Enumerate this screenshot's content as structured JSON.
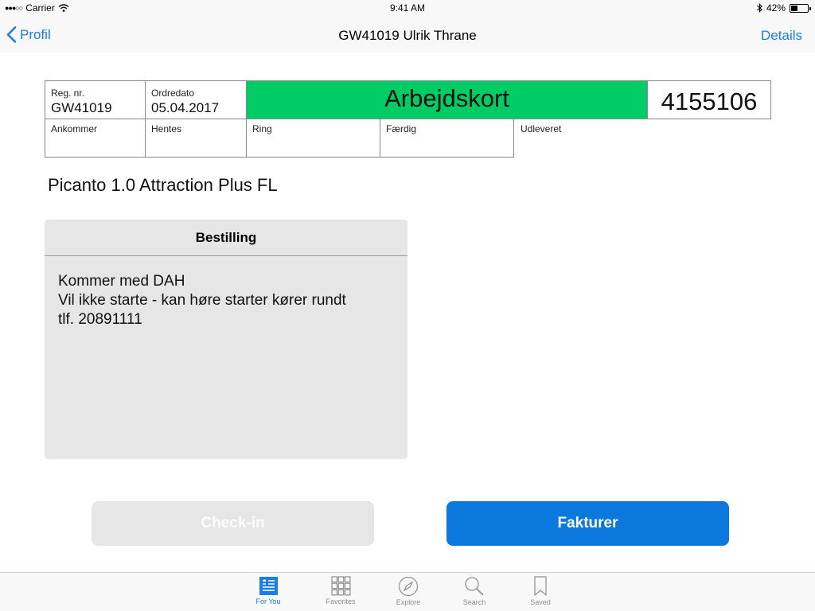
{
  "status_bar": {
    "carrier": "Carrier",
    "time": "9:41 AM",
    "battery": "42%"
  },
  "nav": {
    "back_label": "Profil",
    "title": "GW41019 Ulrik Thrane",
    "details_label": "Details"
  },
  "header": {
    "reg_label": "Reg. nr.",
    "reg_value": "GW41019",
    "ordredato_label": "Ordredato",
    "ordredato_value": "05.04.2017",
    "card_title": "Arbejdskort",
    "order_number": "4155106",
    "ankommer_label": "Ankommer",
    "hentes_label": "Hentes",
    "ring_label": "Ring",
    "faerdig_label": "Færdig",
    "udleveret_label": "Udleveret"
  },
  "model": "Picanto 1.0 Attraction Plus FL",
  "order_card": {
    "title": "Bestilling",
    "lines": [
      "Kommer med DAH",
      "Vil ikke starte - kan høre starter kører rundt",
      "tlf. 20891111"
    ]
  },
  "buttons": {
    "checkin_label": "Check-in",
    "invoice_label": "Fakturer"
  },
  "tabs": [
    {
      "label": "For You",
      "icon": "for-you-icon",
      "active": true
    },
    {
      "label": "Favorites",
      "icon": "grid-icon",
      "active": false
    },
    {
      "label": "Explore",
      "icon": "compass-icon",
      "active": false
    },
    {
      "label": "Search",
      "icon": "search-icon",
      "active": false
    },
    {
      "label": "Saved",
      "icon": "bookmark-icon",
      "active": false
    }
  ],
  "colors": {
    "accent": "#1a7ee5",
    "header_green": "#00cc66",
    "invoice_button": "#0a78dc",
    "disabled_button": "#e6e6e6"
  }
}
